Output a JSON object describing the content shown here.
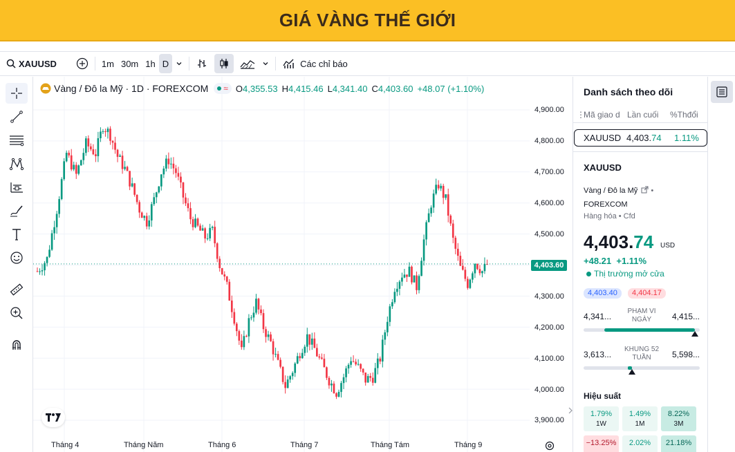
{
  "banner": {
    "title": "GIÁ VÀNG THẾ GIỚI"
  },
  "toolbar": {
    "symbol": "XAUUSD",
    "intervals": [
      "1m",
      "30m",
      "1h",
      "D"
    ],
    "indicators_label": "Các chỉ báo"
  },
  "legend": {
    "title": "Vàng / Đô la Mỹ · 1D · FOREXCOM",
    "open_key": "O",
    "open": "4,355.53",
    "high_key": "H",
    "high": "4,415.46",
    "low_key": "L",
    "low": "4,341.40",
    "close_key": "C",
    "close": "4,403.60",
    "change": "+48.07 (+1.10%)"
  },
  "price_tag": "4,403.60",
  "colors": {
    "up": "#089981",
    "down": "#f23645",
    "banner": "#fbbf24"
  },
  "chart_data": {
    "type": "candlestick",
    "y_ticks": [
      "4,900.00",
      "4,800.00",
      "4,700.00",
      "4,600.00",
      "4,500.00",
      "4,400.00",
      "4,300.00",
      "4,200.00",
      "4,100.00",
      "4,000.00",
      "3,900.00"
    ],
    "x_ticks": [
      "Tháng 4",
      "Tháng Năm",
      "Tháng 6",
      "Tháng 7",
      "Tháng Tám",
      "Tháng 9"
    ],
    "ylim": [
      3880,
      4940
    ],
    "last_price": 4403.6,
    "grid": true
  },
  "watchlist": {
    "title": "Danh sách theo dõi",
    "columns": [
      "Mã giao d",
      "Lần cuối",
      "%Thđổi"
    ],
    "rows": [
      {
        "symbol": "XAUUSD",
        "last_int": "4,403.",
        "last_dec": "74",
        "change": "1.11%"
      }
    ]
  },
  "details": {
    "symbol": "XAUUSD",
    "name": "Vàng / Đô la Mỹ",
    "exchange": "FOREXCOM",
    "category": "Hàng hóa • Cfd",
    "price_int": "4,403.",
    "price_dec": "74",
    "currency": "USD",
    "change_abs": "+48.21",
    "change_pct": "+1.11%",
    "market_status": "Thị trường mở cửa",
    "bid": "4,403.40",
    "ask": "4,404.17",
    "day_range": {
      "label": "PHẠM VI NGÀY",
      "low": "4,341...",
      "high": "4,415...",
      "position": 0.96
    },
    "week52_range": {
      "label": "KHUNG 52 TUẦN",
      "low": "3,613...",
      "high": "5,598...",
      "position": 0.4
    },
    "performance_title": "Hiệu suất",
    "performance": [
      {
        "value": "1.79%",
        "period": "1W",
        "dir": "up"
      },
      {
        "value": "1.49%",
        "period": "1M",
        "dir": "up"
      },
      {
        "value": "8.22%",
        "period": "3M",
        "dir": "up"
      },
      {
        "value": "−13.25%",
        "period": "",
        "dir": "down"
      },
      {
        "value": "2.02%",
        "period": "",
        "dir": "up"
      },
      {
        "value": "21.18%",
        "period": "",
        "dir": "up"
      }
    ]
  }
}
